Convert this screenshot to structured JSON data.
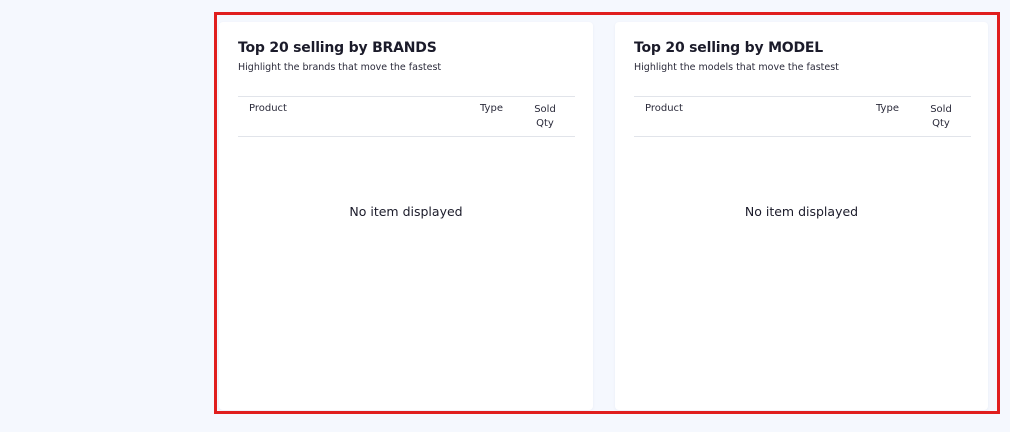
{
  "brands_card": {
    "title": "Top 20 selling by BRANDS",
    "subtitle": "Highlight the brands that move the fastest",
    "columns": {
      "product": "Product",
      "type": "Type",
      "sold_qty": "Sold Qty"
    },
    "empty_message": "No item displayed"
  },
  "model_card": {
    "title": "Top 20 selling by MODEL",
    "subtitle": "Highlight the models that move the fastest",
    "columns": {
      "product": "Product",
      "type": "Type",
      "sold_qty": "Sold Qty"
    },
    "empty_message": "No item displayed"
  },
  "colors": {
    "page_background": "#f5f8fe",
    "card_background": "#ffffff",
    "highlight_border": "#e01e1e",
    "divider": "#e1e4ea"
  }
}
